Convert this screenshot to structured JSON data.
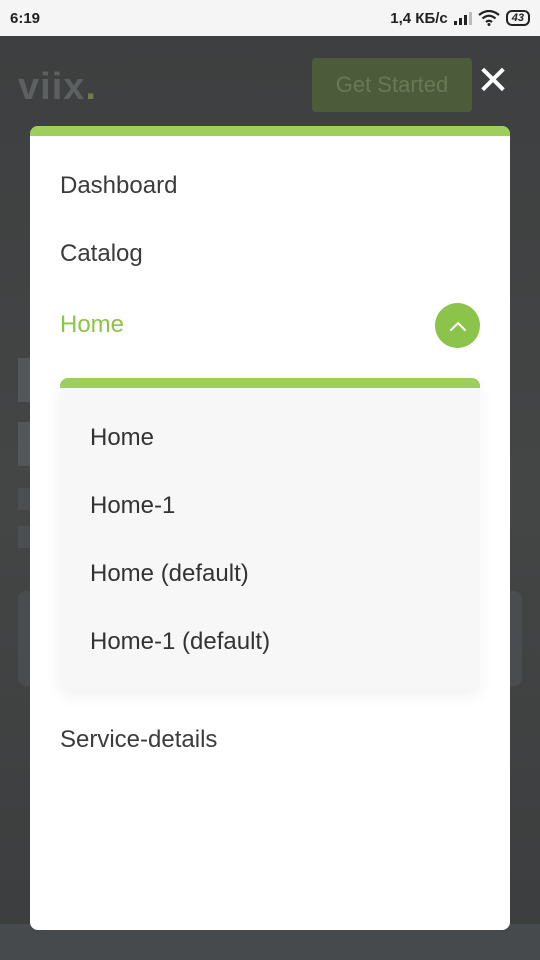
{
  "status_bar": {
    "time": "6:19",
    "network_speed": "1,4 КБ/с",
    "battery": "43"
  },
  "background": {
    "logo": "viix",
    "logo_dot": ".",
    "get_started": "Get Started"
  },
  "menu": {
    "items": [
      {
        "label": "Dashboard"
      },
      {
        "label": "Catalog"
      },
      {
        "label": "Home",
        "active": true
      },
      {
        "label": "Service-details"
      }
    ],
    "home_submenu": [
      {
        "label": "Home"
      },
      {
        "label": "Home-1"
      },
      {
        "label": "Home (default)"
      },
      {
        "label": "Home-1 (default)"
      }
    ],
    "close_symbol": "✕"
  },
  "colors": {
    "accent": "#8cc34a",
    "accent_bar": "#9fcf5b",
    "overlay": "#3a3c3d"
  }
}
